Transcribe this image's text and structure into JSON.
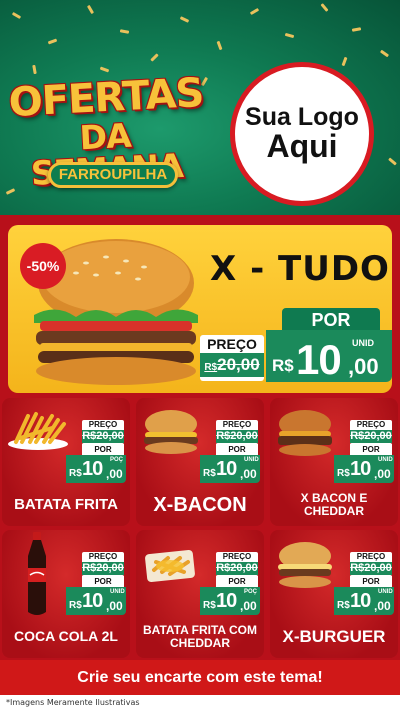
{
  "header": {
    "title_line1": "OFERTAS",
    "title_line2": "DA SEMANA",
    "city": "FARROUPILHA",
    "logo_line1": "Sua Logo",
    "logo_line2": "Aqui"
  },
  "featured": {
    "discount": "-50%",
    "name": "X - TUDO",
    "preco_label": "PREÇO",
    "old_currency": "R$",
    "old_price": "20,00",
    "por_label": "POR",
    "currency": "R$",
    "price_int": "10",
    "price_cents": ",00",
    "unit": "UNID"
  },
  "products": [
    {
      "name": "BATATA FRITA",
      "preco_label": "PREÇO",
      "old_price": "R$20,00",
      "por_label": "POR",
      "currency": "R$",
      "price_int": "10",
      "price_cents": ",00",
      "unit": "POÇ",
      "image": "fries-icon"
    },
    {
      "name": "X-BACON",
      "preco_label": "PREÇO",
      "old_price": "R$20,00",
      "por_label": "POR",
      "currency": "R$",
      "price_int": "10",
      "price_cents": ",00",
      "unit": "UNID",
      "image": "burger-icon"
    },
    {
      "name": "X BACON E CHEDDAR",
      "preco_label": "PREÇO",
      "old_price": "R$20,00",
      "por_label": "POR",
      "currency": "R$",
      "price_int": "10",
      "price_cents": ",00",
      "unit": "UNID",
      "image": "burger-icon"
    },
    {
      "name": "COCA COLA 2L",
      "preco_label": "PREÇO",
      "old_price": "R$20,00",
      "por_label": "POR",
      "currency": "R$",
      "price_int": "10",
      "price_cents": ",00",
      "unit": "UNID",
      "image": "soda-bottle-icon"
    },
    {
      "name": "BATATA FRITA COM CHEDDAR",
      "preco_label": "PREÇO",
      "old_price": "R$20,00",
      "por_label": "POR",
      "currency": "R$",
      "price_int": "10",
      "price_cents": ",00",
      "unit": "POÇ",
      "image": "fries-icon"
    },
    {
      "name": "X-BURGUER",
      "preco_label": "PREÇO",
      "old_price": "R$20,00",
      "por_label": "POR",
      "currency": "R$",
      "price_int": "10",
      "price_cents": ",00",
      "unit": "UNID",
      "image": "burger-icon"
    }
  ],
  "cta": "Crie seu encarte com este tema!",
  "disclaimer": "*Imagens Meramente Ilustrativas",
  "colors": {
    "green": "#0f7a52",
    "red": "#b8101a",
    "gold": "#f7c23a",
    "yellow": "#ffd23c"
  }
}
